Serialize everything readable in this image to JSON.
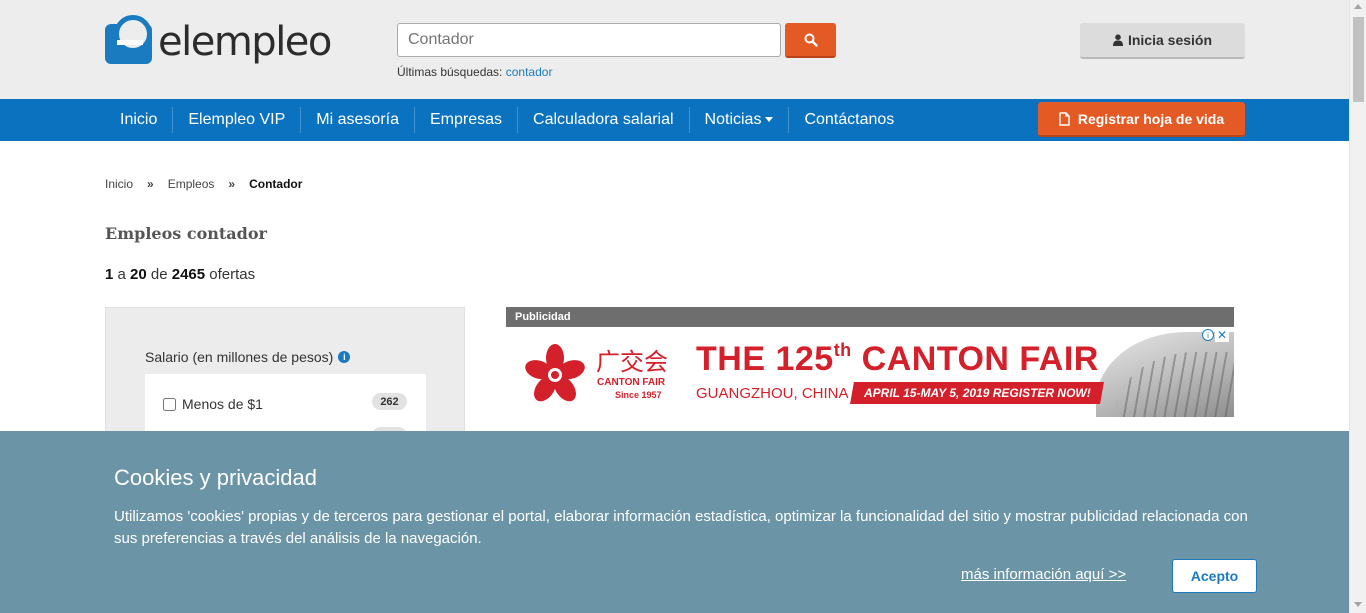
{
  "header": {
    "logo_text": "elempleo",
    "search": {
      "placeholder": "Contador",
      "value": ""
    },
    "recent_label": "Últimas búsquedas:",
    "recent_link": "contador",
    "login_label": "Inicia sesión"
  },
  "nav": {
    "items": [
      {
        "label": "Inicio"
      },
      {
        "label": "Elempleo VIP"
      },
      {
        "label": "Mi asesoría"
      },
      {
        "label": "Empresas"
      },
      {
        "label": "Calculadora salarial"
      },
      {
        "label": "Noticias"
      },
      {
        "label": "Contáctanos"
      }
    ],
    "cv_button": "Registrar hoja de vida"
  },
  "breadcrumb": {
    "items": [
      "Inicio",
      "Empleos",
      "Contador"
    ],
    "separator": "»"
  },
  "page_title": "Empleos contador",
  "results": {
    "from": "1",
    "a": "a",
    "to": "20",
    "de": "de",
    "total": "2465",
    "suffix": "ofertas"
  },
  "filters": {
    "title": "Salario (en millones de pesos)",
    "options": [
      {
        "label": "Menos de $1",
        "count": "262",
        "checked": false
      }
    ]
  },
  "ad": {
    "label": "Publicidad",
    "chinese": "广交会",
    "brand": "CANTON FAIR",
    "since": "Since 1957",
    "title_pre": "THE 125",
    "title_sup": "th",
    "title_post": " CANTON FAIR",
    "city": "GUANGZHOU, CHINA",
    "dates": "APRIL 15-MAY 5, 2019 REGISTER NOW!",
    "close": "✕",
    "info": "i"
  },
  "cookie": {
    "title": "Cookies y privacidad",
    "text": "Utilizamos 'cookies' propias y de terceros para gestionar el portal, elaborar información estadística, optimizar la funcionalidad del sitio y mostrar publicidad relacionada con sus preferencias a través del análisis de la navegación.",
    "more_link": "más información aquí >>",
    "accept": "Acepto"
  },
  "colors": {
    "brand_blue": "#0a72bf",
    "accent_orange": "#e45a25",
    "cookie_bg": "#6b95a6",
    "ad_red": "#d3202a"
  },
  "icons": {
    "search": "search-icon",
    "user": "user-icon",
    "document": "document-icon",
    "info": "info-icon"
  }
}
